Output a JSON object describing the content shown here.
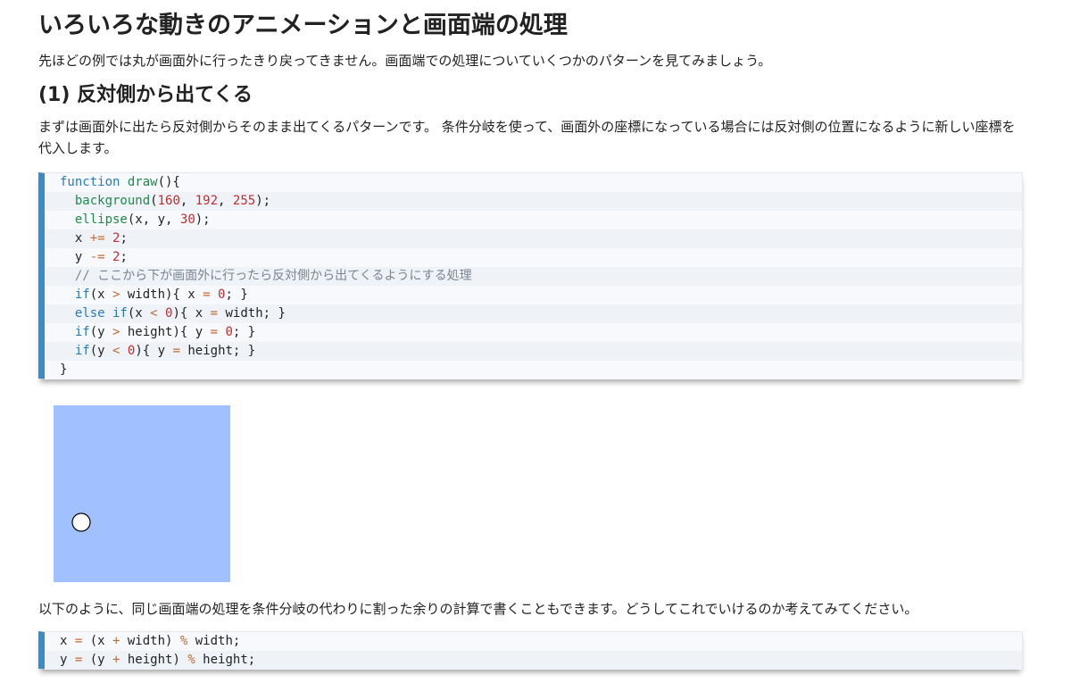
{
  "title": "いろいろな動きのアニメーションと画面端の処理",
  "intro": "先ほどの例では丸が画面外に行ったきり戻ってきません。画面端での処理についていくつかのパターンを見てみましょう。",
  "section1": {
    "heading": "(1) 反対側から出てくる",
    "description": "まずは画面外に出たら反対側からそのまま出てくるパターンです。 条件分岐を使って、画面外の座標になっている場合には反対側の位置になるように新しい座標を代入します。"
  },
  "code_main": [
    [
      {
        "t": "function ",
        "c": "kw"
      },
      {
        "t": "draw",
        "c": "fn"
      },
      {
        "t": "(){",
        "c": ""
      }
    ],
    [
      {
        "t": "  ",
        "c": ""
      },
      {
        "t": "background",
        "c": "fn"
      },
      {
        "t": "(",
        "c": ""
      },
      {
        "t": "160",
        "c": "num"
      },
      {
        "t": ", ",
        "c": ""
      },
      {
        "t": "192",
        "c": "num"
      },
      {
        "t": ", ",
        "c": ""
      },
      {
        "t": "255",
        "c": "num"
      },
      {
        "t": ");",
        "c": ""
      }
    ],
    [
      {
        "t": "  ",
        "c": ""
      },
      {
        "t": "ellipse",
        "c": "fn"
      },
      {
        "t": "(x, y, ",
        "c": ""
      },
      {
        "t": "30",
        "c": "num"
      },
      {
        "t": ");",
        "c": ""
      }
    ],
    [
      {
        "t": "  x ",
        "c": ""
      },
      {
        "t": "+=",
        "c": "op"
      },
      {
        "t": " ",
        "c": ""
      },
      {
        "t": "2",
        "c": "num"
      },
      {
        "t": ";",
        "c": ""
      }
    ],
    [
      {
        "t": "  y ",
        "c": ""
      },
      {
        "t": "-=",
        "c": "op"
      },
      {
        "t": " ",
        "c": ""
      },
      {
        "t": "2",
        "c": "num"
      },
      {
        "t": ";",
        "c": ""
      }
    ],
    [
      {
        "t": "  // ここから下が画面外に行ったら反対側から出てくるようにする処理",
        "c": "cm"
      }
    ],
    [
      {
        "t": "  ",
        "c": ""
      },
      {
        "t": "if",
        "c": "kw"
      },
      {
        "t": "(x ",
        "c": ""
      },
      {
        "t": ">",
        "c": "op"
      },
      {
        "t": " width){ x ",
        "c": ""
      },
      {
        "t": "=",
        "c": "op"
      },
      {
        "t": " ",
        "c": ""
      },
      {
        "t": "0",
        "c": "num"
      },
      {
        "t": "; }",
        "c": ""
      }
    ],
    [
      {
        "t": "  ",
        "c": ""
      },
      {
        "t": "else if",
        "c": "kw"
      },
      {
        "t": "(x ",
        "c": ""
      },
      {
        "t": "<",
        "c": "op"
      },
      {
        "t": " ",
        "c": ""
      },
      {
        "t": "0",
        "c": "num"
      },
      {
        "t": "){ x ",
        "c": ""
      },
      {
        "t": "=",
        "c": "op"
      },
      {
        "t": " width; }",
        "c": ""
      }
    ],
    [
      {
        "t": "  ",
        "c": ""
      },
      {
        "t": "if",
        "c": "kw"
      },
      {
        "t": "(y ",
        "c": ""
      },
      {
        "t": ">",
        "c": "op"
      },
      {
        "t": " height){ y ",
        "c": ""
      },
      {
        "t": "=",
        "c": "op"
      },
      {
        "t": " ",
        "c": ""
      },
      {
        "t": "0",
        "c": "num"
      },
      {
        "t": "; }",
        "c": ""
      }
    ],
    [
      {
        "t": "  ",
        "c": ""
      },
      {
        "t": "if",
        "c": "kw"
      },
      {
        "t": "(y ",
        "c": ""
      },
      {
        "t": "<",
        "c": "op"
      },
      {
        "t": " ",
        "c": ""
      },
      {
        "t": "0",
        "c": "num"
      },
      {
        "t": "){ y ",
        "c": ""
      },
      {
        "t": "=",
        "c": "op"
      },
      {
        "t": " height; }",
        "c": ""
      }
    ],
    [
      {
        "t": "}",
        "c": ""
      }
    ]
  ],
  "canvas_demo": {
    "background": "#a0c0ff",
    "ball_fill": "#ffffff",
    "ball_stroke": "#000000"
  },
  "outro": "以下のように、同じ画面端の処理を条件分岐の代わりに割った余りの計算で書くこともできます。どうしてこれでいけるのか考えてみてください。",
  "code_mod": [
    [
      {
        "t": "x ",
        "c": ""
      },
      {
        "t": "=",
        "c": "op"
      },
      {
        "t": " (x ",
        "c": ""
      },
      {
        "t": "+",
        "c": "op"
      },
      {
        "t": " width) ",
        "c": ""
      },
      {
        "t": "%",
        "c": "op"
      },
      {
        "t": " width;",
        "c": ""
      }
    ],
    [
      {
        "t": "y ",
        "c": ""
      },
      {
        "t": "=",
        "c": "op"
      },
      {
        "t": " (y ",
        "c": ""
      },
      {
        "t": "+",
        "c": "op"
      },
      {
        "t": " height) ",
        "c": ""
      },
      {
        "t": "%",
        "c": "op"
      },
      {
        "t": " height;",
        "c": ""
      }
    ]
  ]
}
